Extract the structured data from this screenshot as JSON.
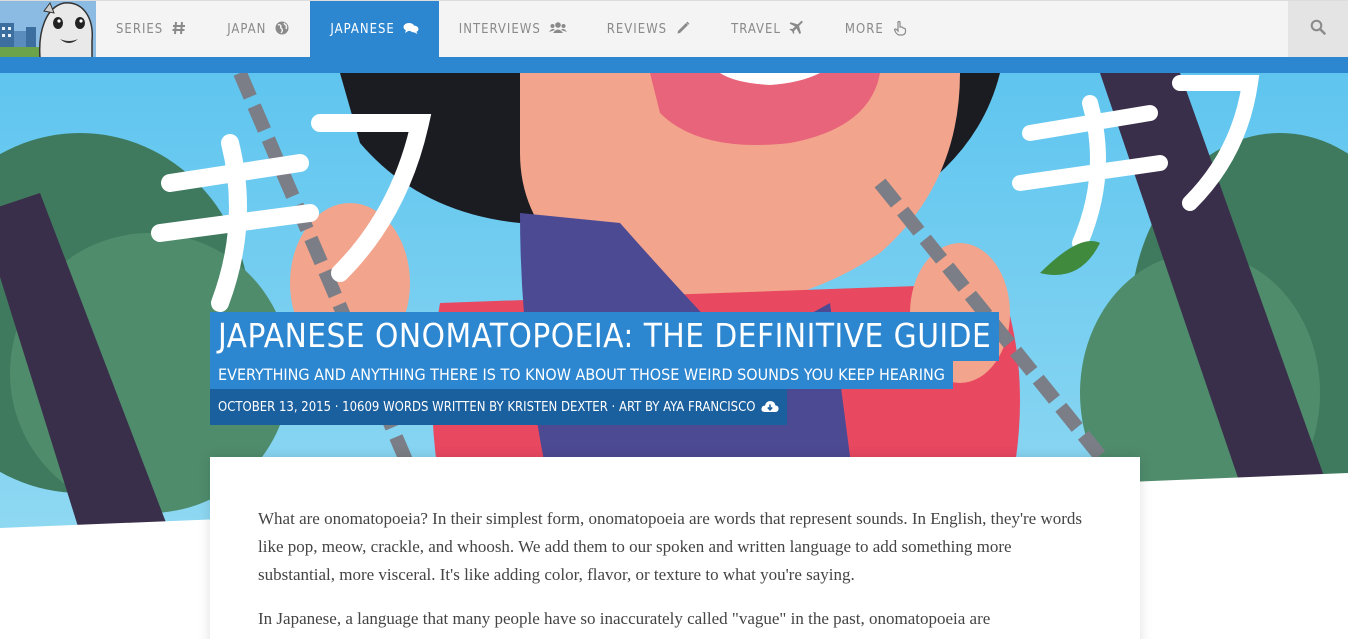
{
  "nav": {
    "items": [
      {
        "label": "SERIES",
        "icon": "hash-icon"
      },
      {
        "label": "JAPAN",
        "icon": "globe-icon"
      },
      {
        "label": "JAPANESE",
        "icon": "comments-icon",
        "active": true
      },
      {
        "label": "INTERVIEWS",
        "icon": "users-icon"
      },
      {
        "label": "REVIEWS",
        "icon": "pencil-icon"
      },
      {
        "label": "TRAVEL",
        "icon": "plane-icon"
      },
      {
        "label": "MORE",
        "icon": "hand-pointer-icon"
      }
    ],
    "search_icon": "search-icon"
  },
  "hero": {
    "title": "JAPANESE ONOMATOPOEIA: THE DEFINITIVE GUIDE",
    "subtitle": "EVERYTHING AND ANYTHING THERE IS TO KNOW ABOUT THOSE WEIRD SOUNDS YOU KEEP HEARING",
    "meta": "OCTOBER 13, 2015 · 10609 WORDS WRITTEN BY KRISTEN DEXTER · ART BY AYA FRANCISCO",
    "meta_icon": "cloud-download-icon"
  },
  "article": {
    "p1": "What are onomatopoeia? In their simplest form, onomatopoeia are words that represent sounds. In English, they're words like pop, meow, crackle, and whoosh. We add them to our spoken and written language to add something more substantial, more visceral. It's like adding color, flavor, or texture to what you're saying.",
    "p2": "In Japanese, a language that many people have so inaccurately called \"vague\" in the past, onomatopoeia are"
  },
  "colors": {
    "accent": "#2d86d0",
    "accent_dark": "#1a5f9e",
    "nav_bg": "#f4f4f4"
  }
}
